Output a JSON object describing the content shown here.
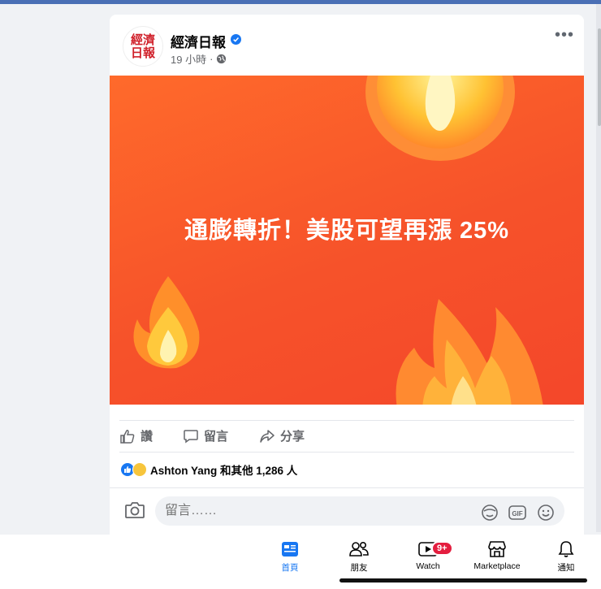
{
  "post": {
    "page_name": "經濟日報",
    "avatar_text_top": "經濟",
    "avatar_text_bottom": "日報",
    "time": "19 小時",
    "separator": "·",
    "banner_text": "通膨轉折！美股可望再漲 25%"
  },
  "actions": {
    "like": "讚",
    "comment": "留言",
    "share": "分享"
  },
  "reactions": {
    "summary": "Ashton Yang 和其他 1,286 人"
  },
  "comment": {
    "placeholder": "留言……"
  },
  "tabs": [
    {
      "label": "首頁",
      "icon": "home-icon"
    },
    {
      "label": "朋友",
      "icon": "friends-icon"
    },
    {
      "label": "Watch",
      "icon": "watch-icon",
      "badge": "9+"
    },
    {
      "label": "Marketplace",
      "icon": "marketplace-icon"
    },
    {
      "label": "通知",
      "icon": "bell-icon"
    }
  ],
  "colors": {
    "brand_blue": "#1877f2",
    "banner_orange": "#f6522a",
    "badge_red": "#e41e3f"
  }
}
